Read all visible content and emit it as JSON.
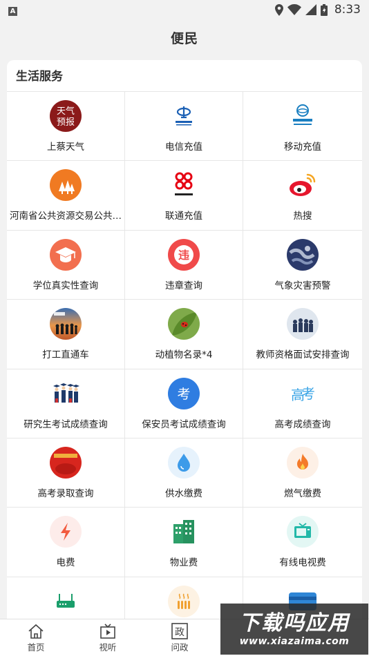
{
  "status_bar": {
    "time": "8:33",
    "app_icon_letter": "A"
  },
  "header": {
    "title": "便民"
  },
  "section": {
    "title": "生活服务",
    "items": [
      {
        "label": "上蔡天气",
        "icon": "weather-forecast-icon",
        "icon_text": "天气预报",
        "color": "#8b1a1a"
      },
      {
        "label": "电信充值",
        "icon": "china-telecom-icon",
        "icon_text": "中国电信",
        "color": "#1a5fb4"
      },
      {
        "label": "移动充值",
        "icon": "china-mobile-icon",
        "icon_text": "中国移动",
        "color": "#1a7fc1"
      },
      {
        "label": "河南省公共资源交易公共…",
        "icon": "trees-icon",
        "color": "#f07a22"
      },
      {
        "label": "联通充值",
        "icon": "china-unicom-icon",
        "icon_text": "中国联通",
        "color": "#e60012"
      },
      {
        "label": "热搜",
        "icon": "weibo-icon",
        "color": "#e6162d"
      },
      {
        "label": "学位真实性查询",
        "icon": "graduation-cap-icon",
        "color": "#f26f4f"
      },
      {
        "label": "违章查询",
        "icon": "traffic-violation-icon",
        "icon_text": "违",
        "color": "#f04a4a"
      },
      {
        "label": "气象灾害预警",
        "icon": "satellite-weather-icon",
        "color": "#2b3a6b"
      },
      {
        "label": "打工直通车",
        "icon": "workers-group-icon",
        "color": "#d9783c"
      },
      {
        "label": "动植物名录*4",
        "icon": "ladybug-leaf-icon",
        "color": "#6a9a3a"
      },
      {
        "label": "教师资格面试安排查询",
        "icon": "teachers-group-icon",
        "color": "#3a5a8c"
      },
      {
        "label": "研究生考试成绩查询",
        "icon": "graduates-group-icon",
        "color": "#2c4a7a"
      },
      {
        "label": "保安员考试成绩查询",
        "icon": "exam-icon",
        "icon_text": "考",
        "color": "#2f7de1"
      },
      {
        "label": "高考成绩查询",
        "icon": "gaokao-text-icon",
        "icon_text": "高考",
        "color": "#3aa4e6"
      },
      {
        "label": "高考录取查询",
        "icon": "admission-banner-icon",
        "color": "#d7261e"
      },
      {
        "label": "供水缴费",
        "icon": "water-drop-icon",
        "color": "#3d9be9"
      },
      {
        "label": "燃气缴费",
        "icon": "flame-icon",
        "color": "#f47b2a"
      },
      {
        "label": "电费",
        "icon": "lightning-icon",
        "color": "#f25b3f"
      },
      {
        "label": "物业费",
        "icon": "buildings-icon",
        "color": "#2ea06a"
      },
      {
        "label": "有线电视费",
        "icon": "tv-icon",
        "color": "#22b8a8"
      },
      {
        "label": "",
        "icon": "router-icon",
        "color": "#1a9e6b"
      },
      {
        "label": "",
        "icon": "heating-icon",
        "color": "#f0a030"
      },
      {
        "label": "",
        "icon": "card-icon",
        "color": "#2f86d6"
      }
    ]
  },
  "bottom_nav": [
    {
      "label": "首页",
      "icon": "home-icon"
    },
    {
      "label": "视听",
      "icon": "video-icon"
    },
    {
      "label": "问政",
      "icon": "gov-icon",
      "icon_text": "政"
    },
    {
      "label": "",
      "icon": ""
    },
    {
      "label": "",
      "icon": ""
    }
  ],
  "watermark": {
    "main": "下载吗应用",
    "sub": "www.xiazaima.com"
  }
}
